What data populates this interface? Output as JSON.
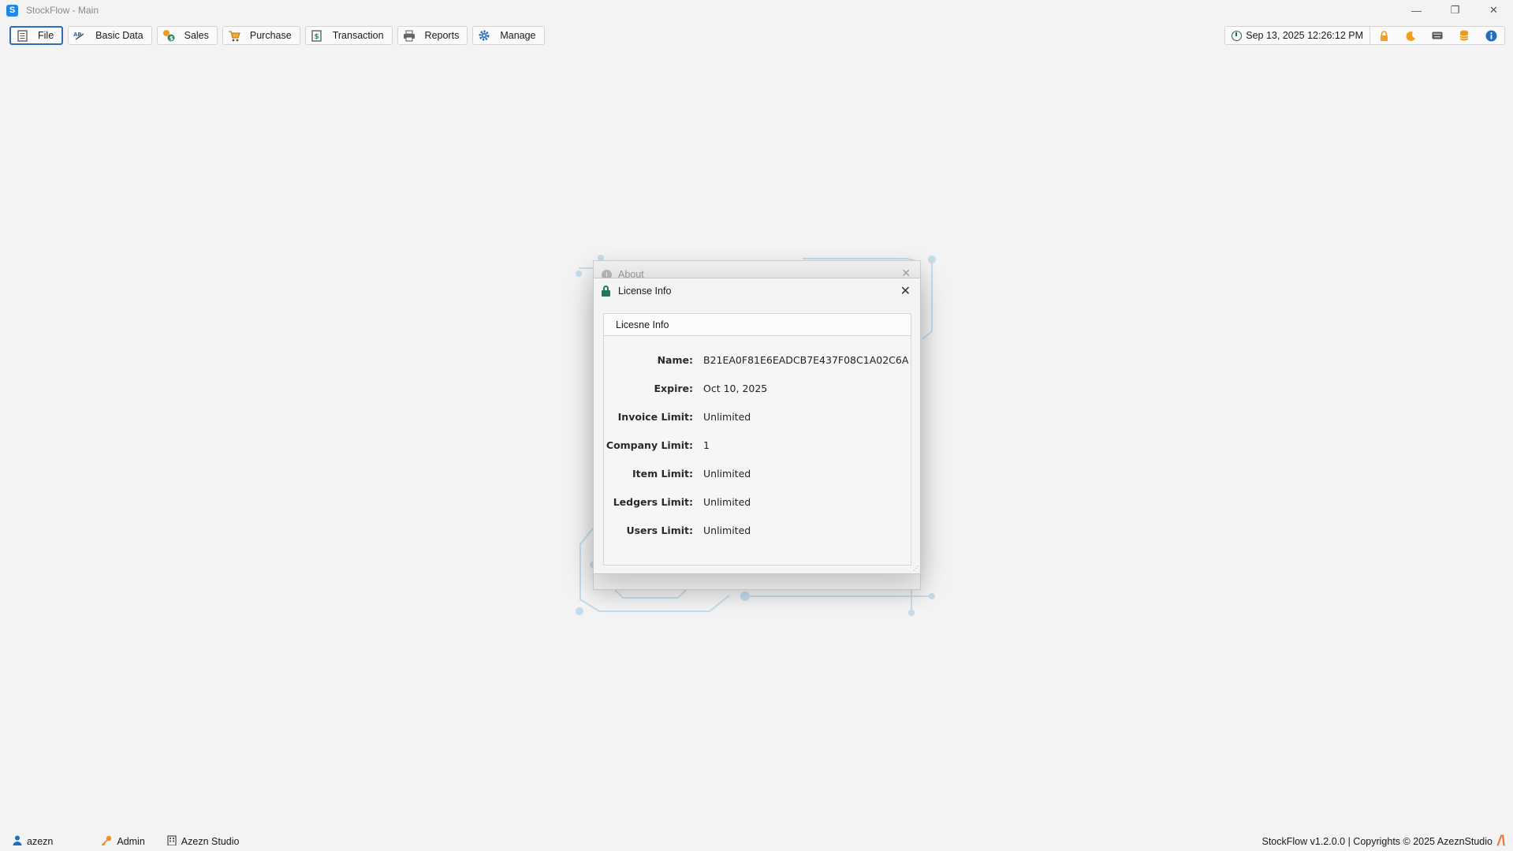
{
  "window": {
    "title": "StockFlow - Main",
    "app_icon_letter": "S",
    "controls": {
      "minimize": "—",
      "restore": "❐",
      "close": "✕"
    }
  },
  "toolbar": {
    "items": [
      {
        "label": "File",
        "icon": "file-icon"
      },
      {
        "label": "Basic Data",
        "icon": "abc-icon"
      },
      {
        "label": "Sales",
        "icon": "sales-icon"
      },
      {
        "label": "Purchase",
        "icon": "cart-icon"
      },
      {
        "label": "Transaction",
        "icon": "dollar-doc-icon"
      },
      {
        "label": "Reports",
        "icon": "printer-icon"
      },
      {
        "label": "Manage",
        "icon": "gear-icon"
      }
    ],
    "datetime": "Sep 13, 2025 12:26:12 PM",
    "tools": [
      "lock-icon",
      "moon-icon",
      "keyboard-icon",
      "database-icon",
      "info-icon"
    ]
  },
  "about_dialog": {
    "title": "About",
    "close": "✕"
  },
  "license_dialog": {
    "title": "License Info",
    "close": "✕",
    "panel_header": "Licesne Info",
    "rows": [
      {
        "key": "Name:",
        "value": "B21EA0F81E6EADCB7E437F08C1A02C6A"
      },
      {
        "key": "Expire:",
        "value": "Oct 10, 2025"
      },
      {
        "key": "Invoice Limit:",
        "value": "Unlimited"
      },
      {
        "key": "Company Limit:",
        "value": "1"
      },
      {
        "key": "Item Limit:",
        "value": "Unlimited"
      },
      {
        "key": "Ledgers Limit:",
        "value": "Unlimited"
      },
      {
        "key": "Users Limit:",
        "value": "Unlimited"
      }
    ]
  },
  "statusbar": {
    "user": "azezn",
    "role": "Admin",
    "company": "Azezn Studio",
    "footer": "StockFlow v1.2.0.0 | Copyrights © 2025 AzeznStudio",
    "brand_mark": "/\\"
  },
  "colors": {
    "accent": "#2d6fb6",
    "brand": "#e8742a",
    "lock": "#1a7a5a",
    "circuit": "#b9d7e8"
  }
}
